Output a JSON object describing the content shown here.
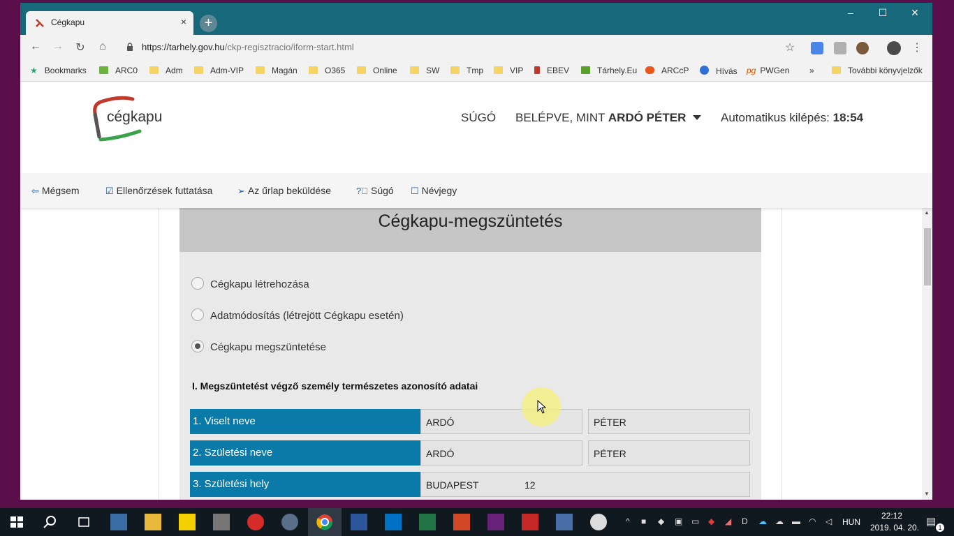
{
  "browser": {
    "tab_title": "Cégkapu",
    "tab_close": "×",
    "new_tab": "+",
    "window_controls": {
      "minimize": "–",
      "maximize": "☐",
      "close": "✕"
    },
    "url_host": "https://tarhely.gov.hu",
    "url_path": "/ckp-regisztracio/iform-start.html",
    "nav": {
      "back": "←",
      "forward": "→",
      "reload": "↻",
      "home": "⌂",
      "star": "☆",
      "menu": "⋮"
    },
    "bookmarks": [
      "Bookmarks",
      "ARC0",
      "Adm",
      "Adm-VIP",
      "Magán",
      "O365",
      "Online",
      "SW",
      "Tmp",
      "VIP",
      "EBEV",
      "Tárhely.Eu",
      "ARCcP",
      "Hívás",
      "PWGen",
      "»",
      "További könyvjelzők"
    ]
  },
  "header": {
    "logo_text": "cégkapu",
    "help": "SÚGÓ",
    "logged_in_prefix": "BELÉPVE, MINT ",
    "logged_in_user": "ARDÓ PÉTER",
    "auto_logout_prefix": "Automatikus kilépés: ",
    "auto_logout_time": "18:54"
  },
  "actions": {
    "cancel": "Mégsem",
    "run_checks": "Ellenőrzések futtatása",
    "submit": "Az űrlap beküldése",
    "help": "Súgó",
    "about": "Névjegy"
  },
  "form": {
    "title": "Cégkapu-megszüntetés",
    "options": [
      {
        "label": "Cégkapu létrehozása",
        "checked": false
      },
      {
        "label": "Adatmódosítás (létrejött Cégkapu esetén)",
        "checked": false
      },
      {
        "label": "Cégkapu megszüntetése",
        "checked": true
      }
    ],
    "section_title": "I. Megszüntetést végző személy természetes azonosító adatai",
    "rows": [
      {
        "label": "1. Viselt neve",
        "v1": "ARDÓ",
        "v2": "PÉTER"
      },
      {
        "label": "2. Születési neve",
        "v1": "ARDÓ",
        "v2": "PÉTER"
      },
      {
        "label": "3. Születési hely",
        "v1": "BUDAPEST",
        "v2": "12"
      }
    ]
  },
  "taskbar": {
    "language": "HUN",
    "time": "22:12",
    "date": "2019. 04. 20.",
    "notification_count": "1"
  },
  "colors": {
    "title_bar": "#16687a",
    "row_label": "#0a7aa9",
    "desktop": "#5a0f4a"
  }
}
